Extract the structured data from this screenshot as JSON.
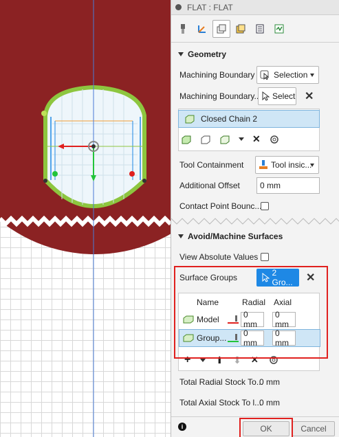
{
  "panel": {
    "title": "FLAT : FLAT",
    "tabs": [
      "tool-icon",
      "geometry-icon",
      "heights-icon",
      "passes-icon",
      "linking-icon",
      "summary-icon"
    ]
  },
  "geometry": {
    "section_title": "Geometry",
    "machining_boundary_label": "Machining Boundary",
    "machining_boundary_value": "Selection",
    "machining_boundary_sel_label": "Machining Boundary...",
    "select_button": "Select",
    "chain_item": "Closed Chain 2",
    "tool_containment_label": "Tool Containment",
    "tool_containment_value": "Tool insic...",
    "additional_offset_label": "Additional Offset",
    "additional_offset_value": "0 mm",
    "contact_point_label": "Contact Point Bounc..."
  },
  "avoid": {
    "section_title": "Avoid/Machine Surfaces",
    "view_absolute_label": "View Absolute Values",
    "surface_groups_label": "Surface Groups",
    "surface_groups_button": "2 Gro...",
    "table": {
      "col_name": "Name",
      "col_radial": "Radial",
      "col_axial": "Axial",
      "rows": [
        {
          "name": "Model",
          "radial": "0 mm",
          "axial": "0 mm"
        },
        {
          "name": "Group...",
          "radial": "0 mm",
          "axial": "0 mm"
        }
      ]
    },
    "total_radial_label": "Total Radial Stock To...",
    "total_radial_value": "0 mm",
    "total_axial_label": "Total Axial Stock To l...",
    "total_axial_value": "0 mm"
  },
  "footer": {
    "ok": "OK",
    "cancel": "Cancel"
  },
  "colors": {
    "stock": "#8b2223",
    "boundary": "#8dc63f",
    "selection_blue": "#1e88e5",
    "highlight_red": "#e0201e"
  }
}
